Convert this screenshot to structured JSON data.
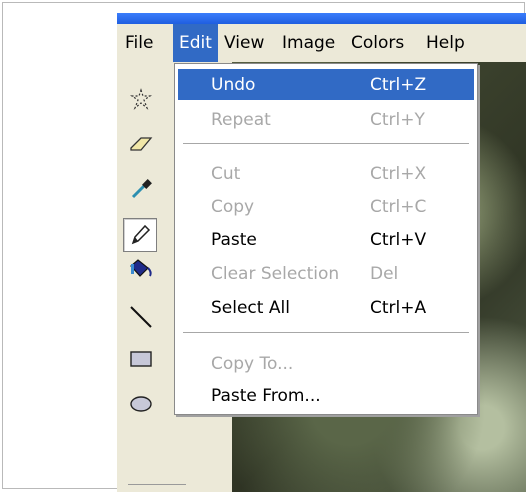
{
  "menubar": {
    "items": [
      "File",
      "Edit",
      "View",
      "Image",
      "Colors",
      "Help"
    ],
    "active_index": 1
  },
  "edit_menu": {
    "items": [
      {
        "label": "Undo",
        "shortcut": "Ctrl+Z",
        "state": "highlighted"
      },
      {
        "label": "Repeat",
        "shortcut": "Ctrl+Y",
        "state": "disabled"
      },
      {
        "label": "Cut",
        "shortcut": "Ctrl+X",
        "state": "disabled"
      },
      {
        "label": "Copy",
        "shortcut": "Ctrl+C",
        "state": "disabled"
      },
      {
        "label": "Paste",
        "shortcut": "Ctrl+V",
        "state": "enabled"
      },
      {
        "label": "Clear Selection",
        "shortcut": "Del",
        "state": "disabled"
      },
      {
        "label": "Select All",
        "shortcut": "Ctrl+A",
        "state": "enabled"
      },
      {
        "label": "Copy To...",
        "shortcut": "",
        "state": "disabled"
      },
      {
        "label": "Paste From...",
        "shortcut": "",
        "state": "enabled"
      }
    ]
  },
  "tools": [
    "free-form-select-icon",
    "eraser-icon",
    "color-picker-icon",
    "pencil-icon",
    "fill-bucket-icon",
    "line-icon",
    "rectangle-icon",
    "ellipse-icon",
    "rounded-rectangle-icon"
  ],
  "colors": {
    "highlight": "#316ac5",
    "menu_bg": "#ffffff",
    "toolbar_bg": "#ece9d8",
    "title_blue": "#2a6df0",
    "disabled_text": "#a8a8a8"
  }
}
